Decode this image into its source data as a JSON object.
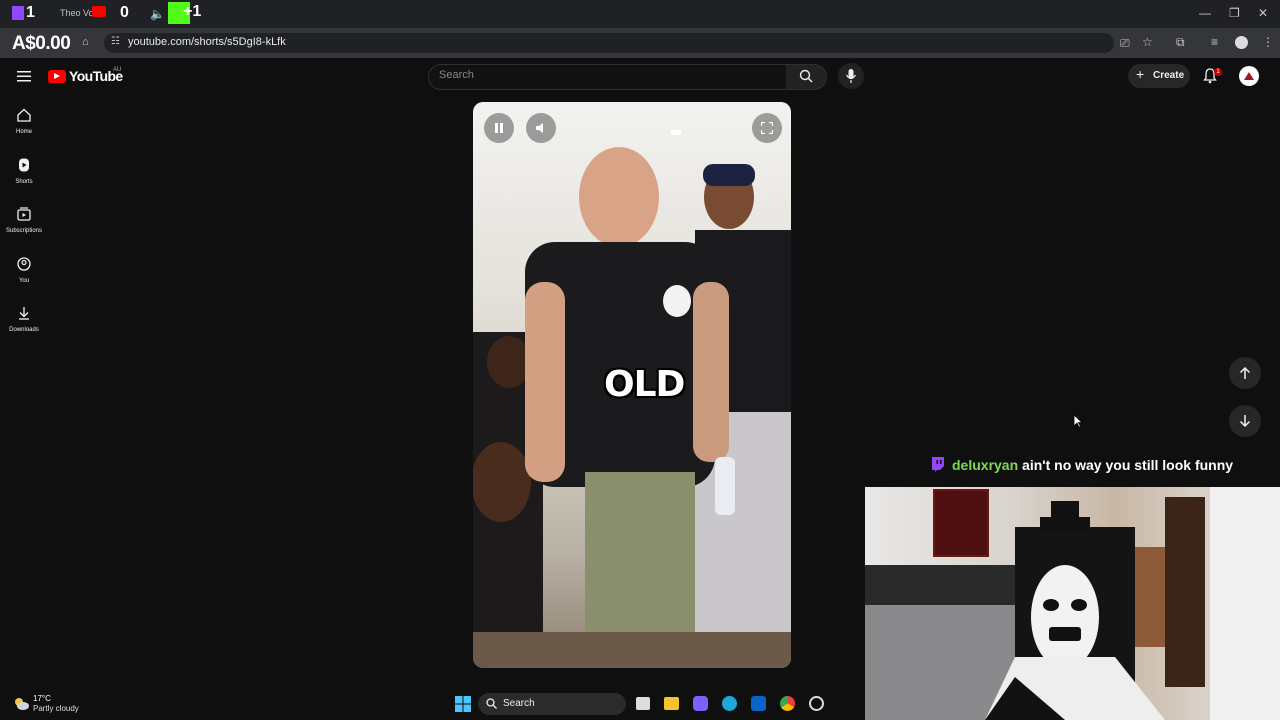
{
  "browser": {
    "tab_title": "Theo Vo",
    "overlay_price": "A$0.00",
    "overlay_counter_a": "1",
    "overlay_counter_b": "0",
    "overlay_counter_c": "+1",
    "url": "youtube.com/shorts/s5DgI8-kLfk"
  },
  "youtube": {
    "logo_text": "YouTube",
    "region": "AU",
    "search_placeholder": "Search",
    "create_label": "Create",
    "notification_count": "1",
    "sidebar": [
      {
        "label": "Home",
        "icon": "home-icon"
      },
      {
        "label": "Shorts",
        "icon": "shorts-icon"
      },
      {
        "label": "Subscriptions",
        "icon": "subscriptions-icon"
      },
      {
        "label": "You",
        "icon": "you-icon"
      },
      {
        "label": "Downloads",
        "icon": "download-icon"
      }
    ]
  },
  "video": {
    "caption": "OLD",
    "state": "playing"
  },
  "stream": {
    "chat_user": "deluxryan",
    "chat_message": "ain't no way you still look funny"
  },
  "taskbar": {
    "temperature": "17°C",
    "weather": "Partly cloudy",
    "search_label": "Search"
  },
  "colors": {
    "yt_red": "#ff0000",
    "chat_user": "#7ed957",
    "twitch_purple": "#9146ff",
    "background": "#0f0f0f"
  }
}
